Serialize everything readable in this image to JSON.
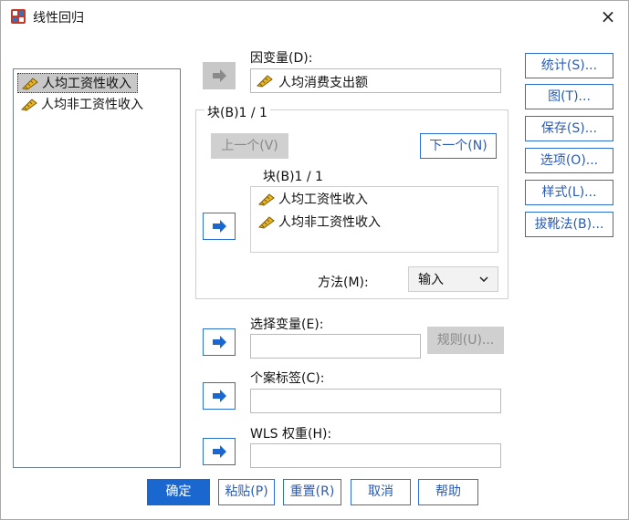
{
  "window": {
    "title": "线性回归",
    "close_label": "×"
  },
  "variables_list": {
    "items": [
      {
        "label": "人均工资性收入",
        "selected": true
      },
      {
        "label": "人均非工资性收入",
        "selected": false
      }
    ]
  },
  "dependent": {
    "label": "因变量(D):",
    "value": "人均消费支出额"
  },
  "block": {
    "group_label": "块(B)1 / 1",
    "prev_label": "上一个(V)",
    "next_label": "下一个(N)",
    "inner_label": "块(B)1 / 1",
    "independents": [
      "人均工资性收入",
      "人均非工资性收入"
    ],
    "method_label": "方法(M):",
    "method_value": "输入"
  },
  "selection": {
    "label": "选择变量(E):",
    "rule_label": "规则(U)..."
  },
  "case_labels": {
    "label": "个案标签(C):"
  },
  "wls": {
    "label": "WLS 权重(H):"
  },
  "side_buttons": [
    "统计(S)...",
    "图(T)...",
    "保存(S)...",
    "选项(O)...",
    "样式(L)...",
    "拔靴法(B)..."
  ],
  "bottom_buttons": {
    "ok": "确定",
    "paste": "粘贴(P)",
    "reset": "重置(R)",
    "cancel": "取消",
    "help": "帮助"
  },
  "colors": {
    "accent": "#1a67d0",
    "disabled": "#c8c8c8"
  }
}
